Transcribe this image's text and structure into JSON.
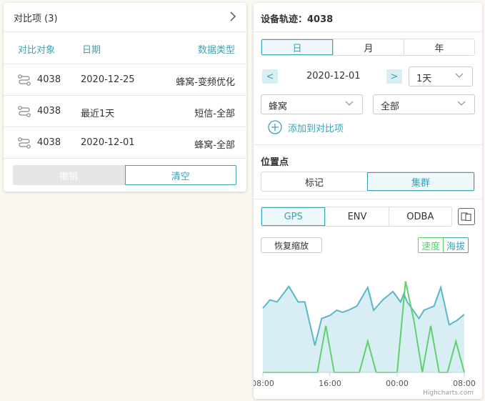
{
  "compare": {
    "title": "对比项  (3)",
    "columns": {
      "object": "对比对象",
      "date": "日期",
      "type": "数据类型"
    },
    "rows": [
      {
        "object": "4038",
        "date": "2020-12-25",
        "type": "蜂窝-变频优化"
      },
      {
        "object": "4038",
        "date": "最近1天",
        "type": "短信-全部"
      },
      {
        "object": "4038",
        "date": "2020-12-01",
        "type": "蜂窝-全部"
      }
    ],
    "cancel_label": "撤销",
    "clear_label": "清空"
  },
  "device": {
    "title": "设备轨迹：4038",
    "period_tabs": [
      "日",
      "月",
      "年"
    ],
    "active_period": "日",
    "prev_label": "<",
    "next_label": ">",
    "date": "2020-12-01",
    "range_select": "1天",
    "network_select": "蜂窝",
    "filter_select": "全部",
    "add_compare_label": "添加到对比项"
  },
  "location": {
    "title": "位置点",
    "tabs": [
      "标记",
      "集群"
    ],
    "active_tab": "集群"
  },
  "data_tabs": [
    "GPS",
    "ENV",
    "ODBA"
  ],
  "active_data_tab": "GPS",
  "reset_zoom_label": "恢复缩放",
  "toggle": {
    "speed": "速度",
    "altitude": "海拔"
  },
  "colors": {
    "accent": "#3aa3b5",
    "speed": "#5fd06a",
    "area_fill": "#d9eef4",
    "area_line": "#5ab6c8"
  },
  "credit": "Highcharts.com",
  "chart_data": {
    "type": "area",
    "x_tick_labels": [
      "08:00",
      "16:00",
      "00:00",
      "08:00"
    ],
    "x_tick_positions": [
      0,
      8,
      16,
      24
    ],
    "xlim": [
      0,
      24
    ],
    "ylim": [
      0,
      100
    ],
    "grid": false,
    "series": [
      {
        "name": "海拔",
        "type": "area",
        "x": [
          0,
          0.85,
          1.7,
          3.1,
          4.2,
          5.0,
          6.2,
          7.0,
          8.0,
          8.8,
          9.5,
          10.2,
          11.2,
          12.5,
          13.2,
          14.3,
          15.5,
          16.4,
          16.8,
          17.2,
          18.6,
          19.2,
          20.4,
          21.2,
          22.2,
          23.1,
          24.0
        ],
        "y": [
          62,
          70,
          68,
          83,
          68,
          68,
          26,
          52,
          55,
          60,
          58,
          60,
          64,
          82,
          60,
          70,
          78,
          68,
          76,
          68,
          52,
          60,
          64,
          82,
          46,
          50,
          56
        ]
      },
      {
        "name": "速度",
        "type": "line",
        "x": [
          0,
          6.5,
          7.5,
          8.5,
          11.5,
          12.5,
          13.5,
          16.0,
          17.0,
          18.0,
          19.0,
          20.0,
          21.0,
          22.0,
          23.0,
          24.0
        ],
        "y": [
          0,
          0,
          45,
          0,
          0,
          30,
          0,
          0,
          88,
          50,
          0,
          45,
          0,
          0,
          30,
          0
        ]
      }
    ]
  }
}
